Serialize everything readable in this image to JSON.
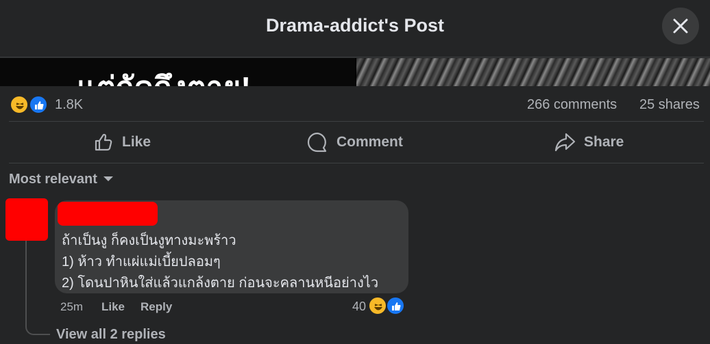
{
  "header": {
    "title": "Drama-addict's Post"
  },
  "media": {
    "overlay_text": "แต่กัดถึงตาย!"
  },
  "stats": {
    "reaction_count": "1.8K",
    "comments": "266 comments",
    "shares": "25 shares",
    "reaction_icons": [
      "haha-icon",
      "like-icon"
    ]
  },
  "actions": {
    "like": "Like",
    "comment": "Comment",
    "share": "Share"
  },
  "sort": {
    "label": "Most relevant"
  },
  "comment": {
    "lines": [
      "ถ้าเป็นงู ก็คงเป็นงูทางมะพร้าว",
      "1) ห้าว ทำแผ่แม่เบี้ยปลอมๆ",
      "2) โดนปาหินใส่แล้วแกล้งตาย ก่อนจะคลานหนีอย่างไว"
    ],
    "time": "25m",
    "like_label": "Like",
    "reply_label": "Reply",
    "reaction_count": "40"
  },
  "replies": {
    "label": "View all 2 replies"
  },
  "colors": {
    "background": "#242526",
    "bubble": "#3a3b3c",
    "redaction": "#ff0000",
    "like_blue": "#1877f2",
    "haha_yellow": "#f7b928"
  }
}
